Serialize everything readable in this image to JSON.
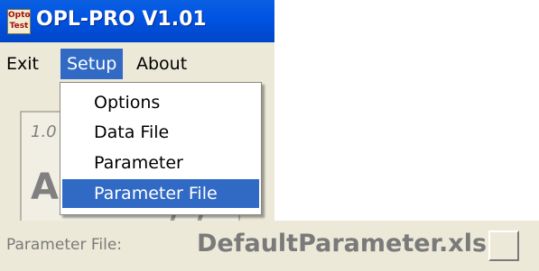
{
  "window": {
    "title": "OPL-PRO V1.01",
    "icon_lines": [
      "Opto",
      "Test"
    ]
  },
  "menubar": {
    "items": [
      {
        "label": "Exit"
      },
      {
        "label": "Setup",
        "active": true
      },
      {
        "label": "About"
      }
    ]
  },
  "setup_menu": {
    "items": [
      {
        "label": "Options"
      },
      {
        "label": "Data File"
      },
      {
        "label": "Parameter"
      },
      {
        "label": "Parameter File",
        "selected": true
      }
    ]
  },
  "panel": {
    "number_fragment": "1.0",
    "letter": "A",
    "partial_glyph": "/ /"
  },
  "status": {
    "label": "Parameter File:",
    "value": "DefaultParameter.xls"
  },
  "colors": {
    "titlebar": "#0054e3",
    "highlight": "#316ac5",
    "face": "#ece9d8"
  }
}
